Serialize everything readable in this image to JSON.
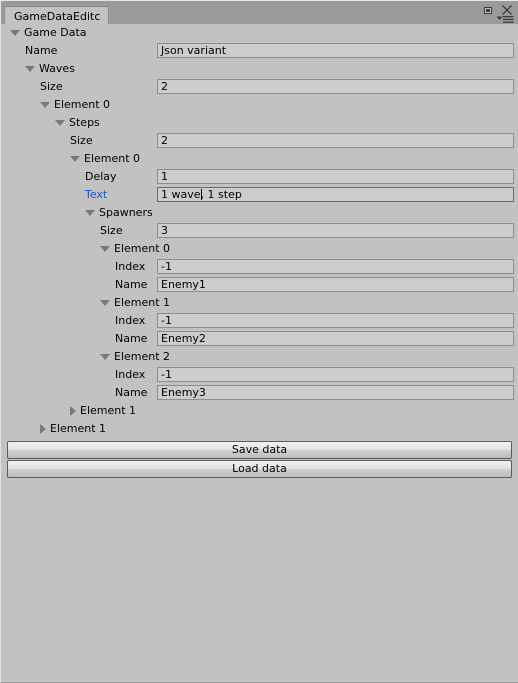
{
  "window": {
    "tab_label": "GameDataEditc",
    "maximize_icon": "maximize-icon",
    "close_icon": "close-icon",
    "menu_icon": "panel-menu-icon",
    "accent_focus_color": "#2155c5",
    "field_border_focus_color": "#4f63d2",
    "background_color": "#c2c2c2",
    "field_background_color": "#cdcdcd"
  },
  "rows": [
    {
      "kind": "foldout",
      "indent": 0,
      "label": "Game Data",
      "open": true
    },
    {
      "kind": "field",
      "indent": 1,
      "label": "Name",
      "value": "Json variant"
    },
    {
      "kind": "foldout",
      "indent": 1,
      "label": "Waves",
      "open": true
    },
    {
      "kind": "field",
      "indent": 2,
      "label": "Size",
      "value": "2"
    },
    {
      "kind": "foldout",
      "indent": 2,
      "label": "Element 0",
      "open": true
    },
    {
      "kind": "foldout",
      "indent": 3,
      "label": "Steps",
      "open": true
    },
    {
      "kind": "field",
      "indent": 4,
      "label": "Size",
      "value": "2"
    },
    {
      "kind": "foldout",
      "indent": 4,
      "label": "Element 0",
      "open": true
    },
    {
      "kind": "field",
      "indent": 5,
      "label": "Delay",
      "value": "1"
    },
    {
      "kind": "field",
      "indent": 5,
      "label": "Text",
      "value": "1 wave, 1 step",
      "focused": true,
      "caret_after": 6
    },
    {
      "kind": "foldout",
      "indent": 5,
      "label": "Spawners",
      "open": true
    },
    {
      "kind": "field",
      "indent": 6,
      "label": "Size",
      "value": "3"
    },
    {
      "kind": "foldout",
      "indent": 6,
      "label": "Element 0",
      "open": true
    },
    {
      "kind": "field",
      "indent": 7,
      "label": "Index",
      "value": "-1"
    },
    {
      "kind": "field",
      "indent": 7,
      "label": "Name",
      "value": "Enemy1"
    },
    {
      "kind": "foldout",
      "indent": 6,
      "label": "Element 1",
      "open": true
    },
    {
      "kind": "field",
      "indent": 7,
      "label": "Index",
      "value": "-1"
    },
    {
      "kind": "field",
      "indent": 7,
      "label": "Name",
      "value": "Enemy2"
    },
    {
      "kind": "foldout",
      "indent": 6,
      "label": "Element 2",
      "open": true
    },
    {
      "kind": "field",
      "indent": 7,
      "label": "Index",
      "value": "-1"
    },
    {
      "kind": "field",
      "indent": 7,
      "label": "Name",
      "value": "Enemy3"
    },
    {
      "kind": "foldout",
      "indent": 4,
      "label": "Element 1",
      "open": false
    },
    {
      "kind": "foldout",
      "indent": 2,
      "label": "Element 1",
      "open": false
    }
  ],
  "buttons": [
    {
      "label": "Save data",
      "name": "save-data-button"
    },
    {
      "label": "Load data",
      "name": "load-data-button"
    }
  ]
}
